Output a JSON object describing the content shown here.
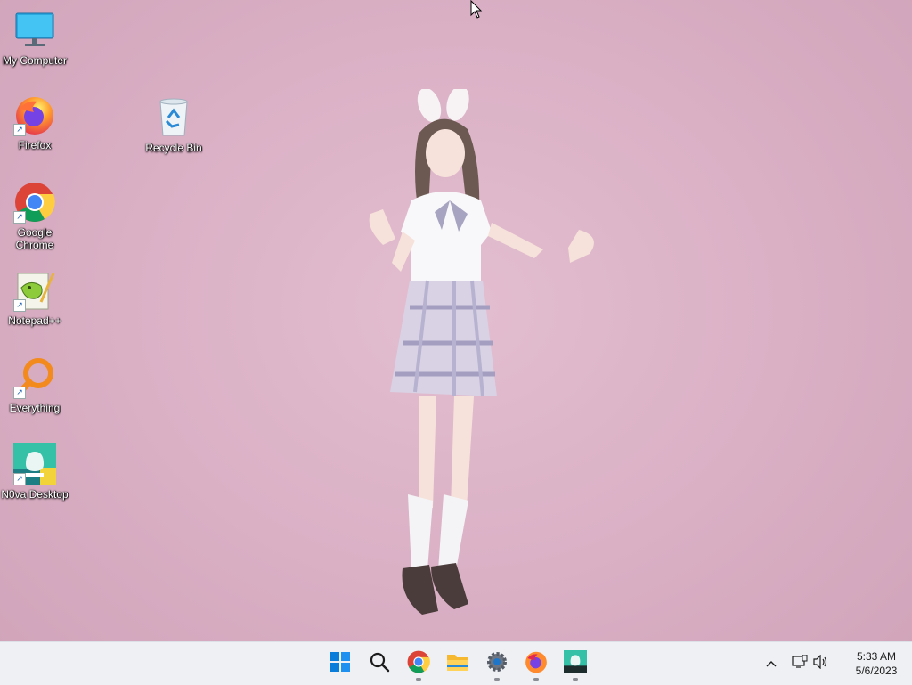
{
  "desktop": {
    "icons": [
      {
        "label": "My Computer",
        "icon": "monitor-icon"
      },
      {
        "label": "Firefox",
        "icon": "firefox-icon"
      },
      {
        "label": "Google Chrome",
        "icon": "chrome-icon"
      },
      {
        "label": "Notepad++",
        "icon": "notepadpp-icon"
      },
      {
        "label": "Everything",
        "icon": "everything-icon"
      },
      {
        "label": "N0va Desktop",
        "icon": "nova-desktop-icon"
      },
      {
        "label": "Recycle Bin",
        "icon": "recycle-bin-icon"
      }
    ],
    "wallpaper": "anime girl with bunny ears on pink background"
  },
  "taskbar": {
    "apps": [
      {
        "name": "start",
        "icon": "windows-start-icon",
        "running": false
      },
      {
        "name": "search",
        "icon": "search-icon",
        "running": false
      },
      {
        "name": "chrome",
        "icon": "chrome-icon",
        "running": true
      },
      {
        "name": "file-explorer",
        "icon": "folder-icon",
        "running": false
      },
      {
        "name": "settings",
        "icon": "settings-gear-icon",
        "running": true
      },
      {
        "name": "firefox",
        "icon": "firefox-icon",
        "running": true
      },
      {
        "name": "nova-desktop",
        "icon": "nova-desktop-icon",
        "running": true
      }
    ],
    "tray": {
      "time": "5:33 AM",
      "date": "5/6/2023"
    }
  },
  "colors": {
    "wallpaper": "#dbb2c6",
    "taskbar": "#eef0f4",
    "accent": "#0078d4"
  }
}
